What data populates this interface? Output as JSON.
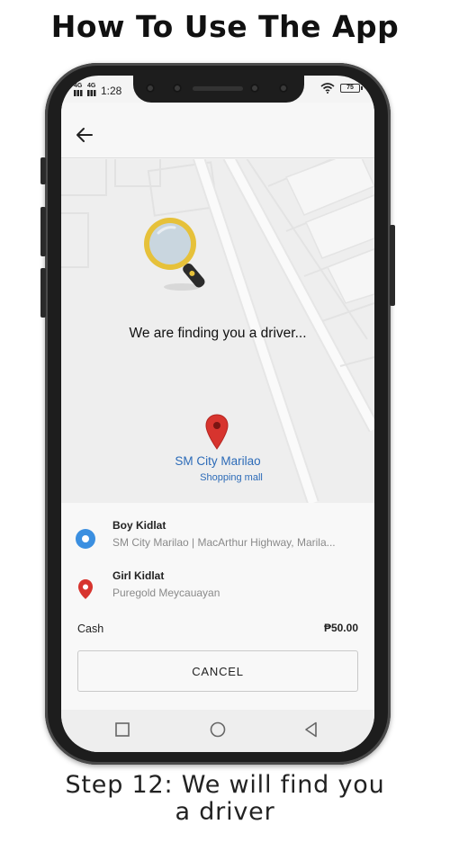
{
  "page": {
    "headline": "How To Use The App",
    "caption_line1": "Step 12: We will find you",
    "caption_line2": "a driver"
  },
  "status_bar": {
    "network_1": "4G",
    "network_2": "4G",
    "time": "1:28",
    "battery": "75"
  },
  "header": {
    "back_icon": "arrow-left-icon"
  },
  "search": {
    "message": "We are finding you a driver...",
    "icon": "magnifier-icon"
  },
  "map": {
    "place_name": "SM City Marilao",
    "place_type": "Shopping mall",
    "pin_icon": "map-pin-icon"
  },
  "trip": {
    "pickup": {
      "name": "Boy Kidlat",
      "address": "SM City Marilao | MacArthur Highway, Marila...",
      "icon": "pickup-dot-icon"
    },
    "dropoff": {
      "name": "Girl Kidlat",
      "address": "Puregold Meycauayan",
      "icon": "dropoff-pin-icon"
    },
    "payment_method": "Cash",
    "fare": "₱50.00",
    "cancel_label": "CANCEL"
  },
  "navbar": {
    "recents_icon": "square-icon",
    "home_icon": "circle-icon",
    "back_icon": "triangle-back-icon"
  },
  "colors": {
    "pin_red": "#d7342e",
    "pickup_blue": "#3b8fe0",
    "link_blue": "#2c6bb8",
    "magnifier_gold": "#e6c13a",
    "phone_body": "#1d1d1d"
  }
}
